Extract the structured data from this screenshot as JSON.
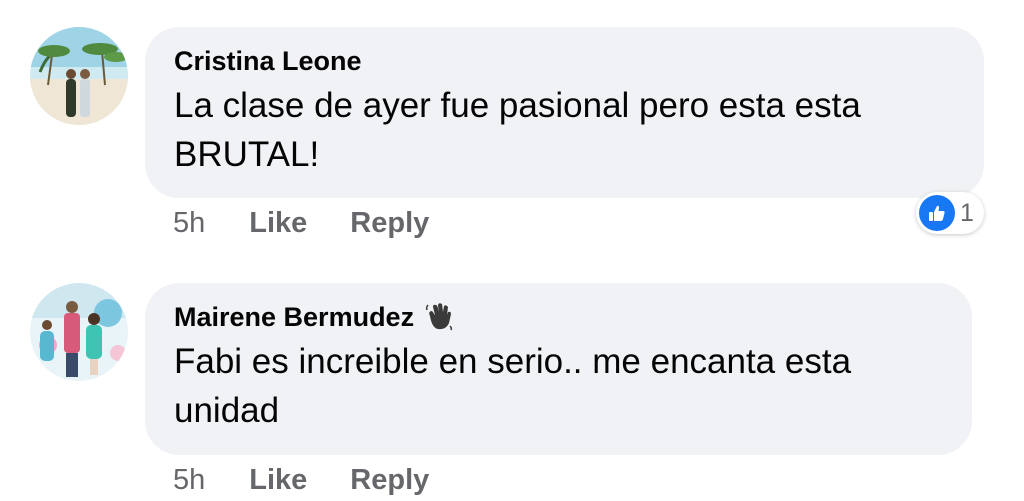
{
  "comments": [
    {
      "author": "Cristina Leone",
      "text": "La clase de ayer fue pasional pero esta esta BRUTAL!",
      "time": "5h",
      "like_label": "Like",
      "reply_label": "Reply",
      "reaction": {
        "icon": "like-icon",
        "count": "1"
      }
    },
    {
      "author": "Mairene Bermudez",
      "author_emoji": "waving-hand-icon",
      "text": "Fabi es increible en serio.. me encanta esta unidad",
      "time": "5h",
      "like_label": "Like",
      "reply_label": "Reply"
    }
  ],
  "colors": {
    "bubble": "#f0f2f5",
    "secondary_text": "#65676b",
    "like_blue": "#1877f2"
  }
}
